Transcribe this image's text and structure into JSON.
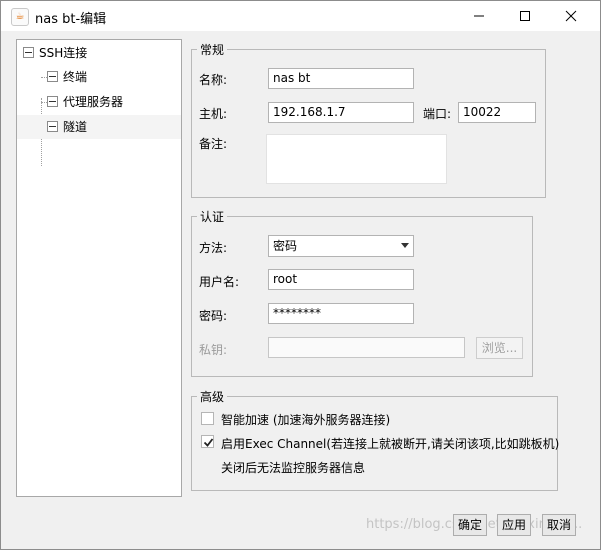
{
  "window": {
    "title": "nas bt-编辑"
  },
  "tree": {
    "root": "SSH连接",
    "children": [
      "终端",
      "代理服务器",
      "隧道"
    ]
  },
  "general": {
    "legend": "常规",
    "name_label": "名称:",
    "name_value": "nas bt",
    "host_label": "主机:",
    "host_value": "192.168.1.7",
    "port_label": "端口:",
    "port_value": "10022",
    "note_label": "备注:"
  },
  "auth": {
    "legend": "认证",
    "method_label": "方法:",
    "method_value": "密码",
    "user_label": "用户名:",
    "user_value": "root",
    "password_label": "密码:",
    "password_value": "********",
    "key_label": "私钥:",
    "browse_label": "浏览..."
  },
  "advanced": {
    "legend": "高级",
    "smart_accel_label": "智能加速 (加速海外服务器连接)",
    "smart_accel_checked": false,
    "exec_channel_label": "启用Exec Channel(若连接上就被断开,请关闭该项,比如跳板机)",
    "exec_channel_checked": true,
    "exec_channel_note": "关闭后无法监控服务器信息"
  },
  "buttons": {
    "ok": "确定",
    "apply": "应用",
    "cancel": "取消"
  },
  "watermark": "https://blog.csdn.net/weixin_42..."
}
